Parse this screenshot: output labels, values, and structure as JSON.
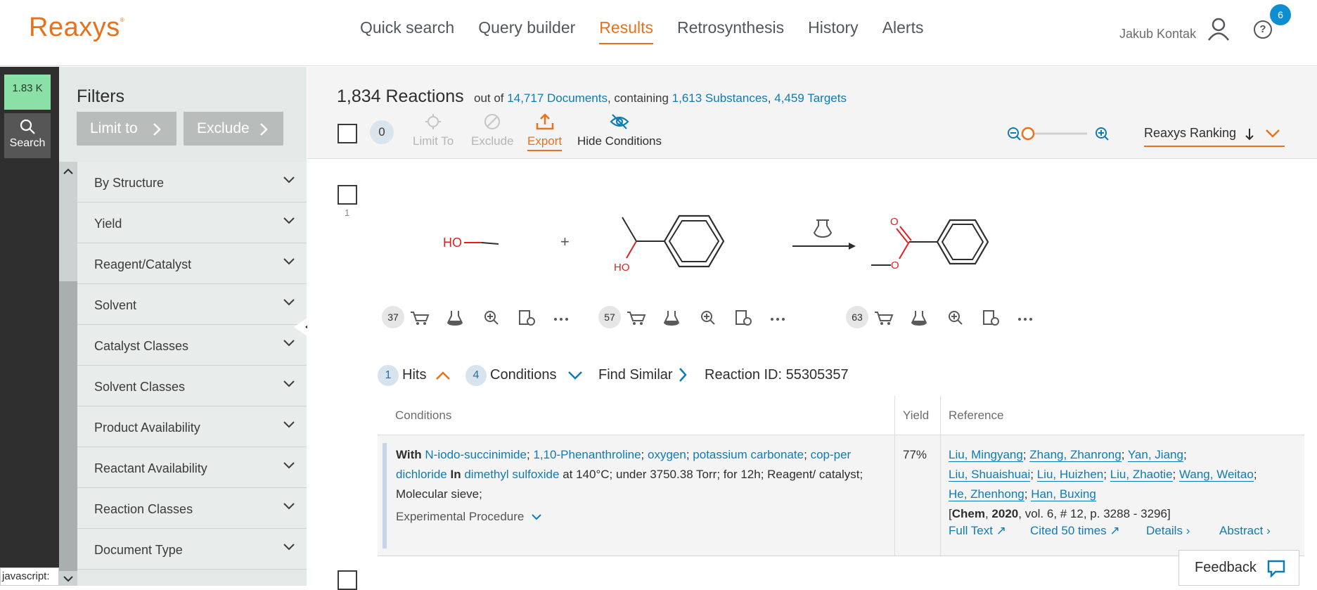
{
  "brand": {
    "name": "Reaxys",
    "mark": "®",
    "color": "#e9711c"
  },
  "nav": {
    "items": [
      "Quick search",
      "Query builder",
      "Results",
      "Retrosynthesis",
      "History",
      "Alerts"
    ],
    "active": "Results"
  },
  "user": {
    "name": "Jakub Kontak",
    "notifications": "6"
  },
  "rail": {
    "badge": "1.83 K",
    "search_label": "Search"
  },
  "filters": {
    "title": "Filters",
    "limit_label": "Limit to",
    "exclude_label": "Exclude",
    "items": [
      "By Structure",
      "Yield",
      "Reagent/Catalyst",
      "Solvent",
      "Catalyst Classes",
      "Solvent Classes",
      "Product Availability",
      "Reactant Availability",
      "Reaction Classes",
      "Document Type"
    ]
  },
  "results": {
    "count_text": "1,834 Reactions",
    "out_of": "out of",
    "documents": "14,717 Documents",
    "containing": ", containing",
    "substances": "1,613 Substances",
    "sep": ",",
    "targets": "4,459 Targets"
  },
  "toolbar": {
    "selected": "0",
    "limit": "Limit To",
    "exclude": "Exclude",
    "export": "Export",
    "hide": "Hide Conditions",
    "ranking": "Reaxys Ranking"
  },
  "reaction": {
    "index": "1",
    "reactant1_counts": "37",
    "reactant2_counts": "57",
    "product_counts": "63",
    "mol_labels": {
      "ho1": "HO",
      "ho2": "HO",
      "o_dbl": "O",
      "o_single": "O"
    },
    "hits_count": "1",
    "hits_label": "Hits",
    "cond_count": "4",
    "cond_label": "Conditions",
    "find_similar": "Find Similar",
    "reaction_id": "Reaction ID: 55305357"
  },
  "table": {
    "headers": {
      "conditions": "Conditions",
      "yield": "Yield",
      "reference": "Reference"
    },
    "row": {
      "with": "With",
      "reagents": [
        "N-iodo-succinimide",
        "1,10-Phenanthroline",
        "oxygen",
        "potassium carbonate",
        "cop-per dichloride"
      ],
      "in": "In",
      "solvent": "dimethyl sulfoxide",
      "rest": "at 140°C; under 3750.38 Torr; for 12h; Reagent/ catalyst; Molecular sieve;",
      "exp_proc": "Experimental Procedure",
      "yield": "77%",
      "authors": [
        "Liu, Mingyang",
        "Zhang, Zhanrong",
        "Yan, Jiang",
        "Liu, Shuaishuai",
        "Liu, Huizhen",
        "Liu, Zhaotie",
        "Wang, Weitao",
        "He, Zhenhong",
        "Han, Buxing"
      ],
      "journal": "Chem",
      "year": "2020",
      "citation": ", vol. 6, # 12, p. 3288 - 3296",
      "links": {
        "fulltext": "Full Text",
        "cited": "Cited 50 times",
        "details": "Details",
        "abstract": "Abstract"
      }
    }
  },
  "misc": {
    "feedback": "Feedback",
    "status": "javascript:"
  }
}
